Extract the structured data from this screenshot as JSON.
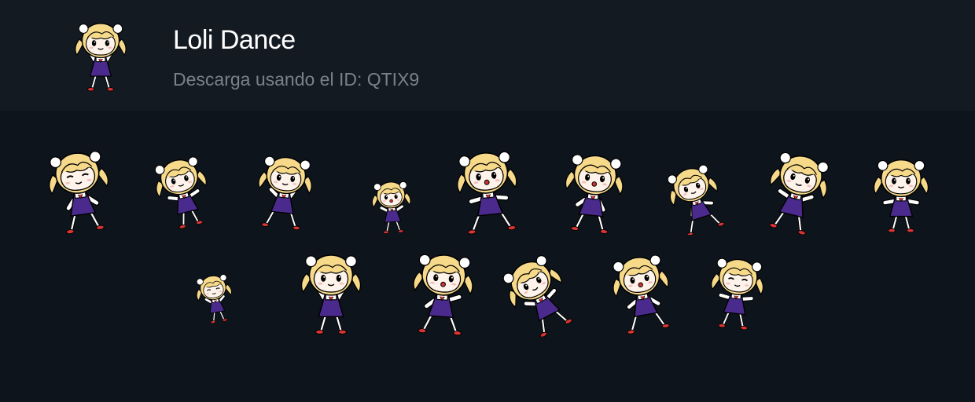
{
  "pack": {
    "title": "Loli Dance",
    "subtitle": "Descarga usando el ID: QTIX9",
    "icon": "chibi-dancer-icon"
  },
  "colors": {
    "background": "#0e141b",
    "header": "#131a22",
    "hair": "#f7d98a",
    "dress": "#4a2a8c",
    "shoes": "#d83434"
  },
  "stickers": [
    {
      "id": 1,
      "pose": "eyes-closed-lean"
    },
    {
      "id": 2,
      "pose": "profile-turn"
    },
    {
      "id": 3,
      "pose": "kick-left"
    },
    {
      "id": 4,
      "pose": "small-hop"
    },
    {
      "id": 5,
      "pose": "wide-step"
    },
    {
      "id": 6,
      "pose": "point-mouth"
    },
    {
      "id": 7,
      "pose": "lunge"
    },
    {
      "id": 8,
      "pose": "head-tilt"
    },
    {
      "id": 9,
      "pose": "twin-tails"
    },
    {
      "id": 10,
      "pose": "tiny-twirl"
    },
    {
      "id": 11,
      "pose": "heart-hands"
    },
    {
      "id": 12,
      "pose": "cheer-arms"
    },
    {
      "id": 13,
      "pose": "bow-forward"
    },
    {
      "id": 14,
      "pose": "side-lean"
    },
    {
      "id": 15,
      "pose": "sleepy-sway"
    }
  ]
}
